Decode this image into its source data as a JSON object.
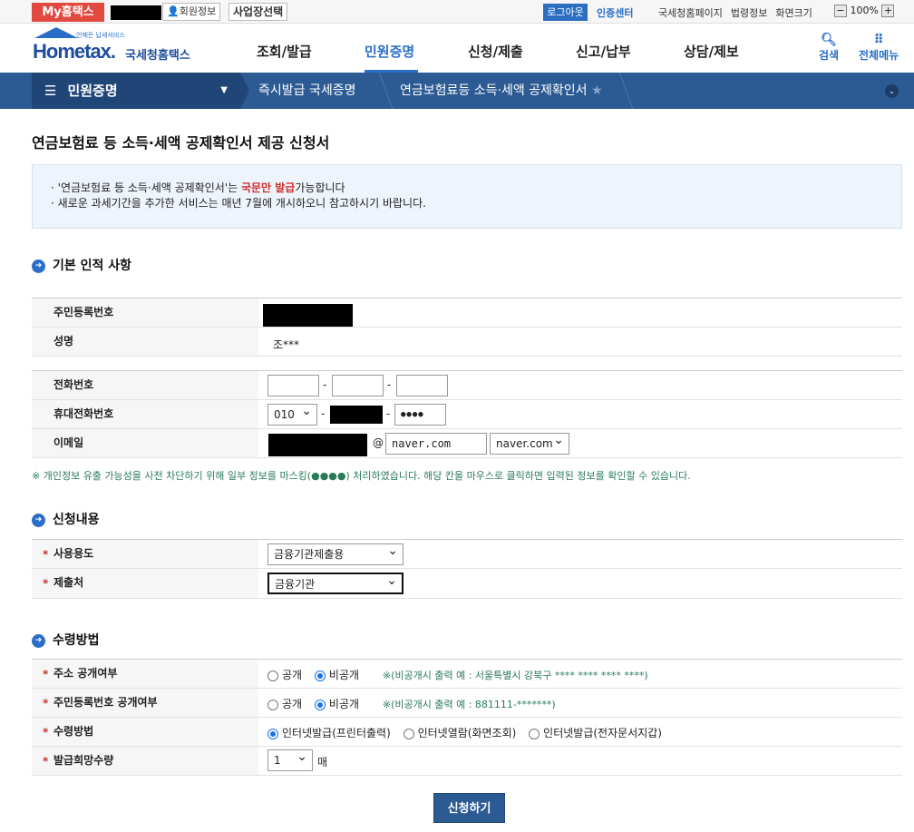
{
  "topbar": {
    "my_label": "My홈택스",
    "member_info": "회원정보",
    "business_select": "사업장선택",
    "logout": "로그아웃",
    "cert_center": "인증센터",
    "links": [
      "국세청홈페이지",
      "법령정보",
      "화면크기"
    ],
    "zoom": "100%"
  },
  "header": {
    "logo_sub": "언제든 납세서비스",
    "logo_home": "Home",
    "logo_tax": "tax.",
    "logo_kr": "국세청홈택스",
    "menu": [
      "조회/발급",
      "민원증명",
      "신청/제출",
      "신고/납부",
      "상담/제보"
    ],
    "active_menu": "민원증명",
    "search": "검색",
    "all_menu": "전체메뉴"
  },
  "navbar": {
    "menu": "민원증명",
    "crumb1": "즉시발급 국세증명",
    "crumb2": "연금보험료등 소득·세액 공제확인서"
  },
  "page_title": "연금보험료 등 소득·세액 공제확인서 제공 신청서",
  "info": {
    "line1_pre": "'연금보험료 등 소득·세액 공제확인서'는",
    "line1_red": "국문만 발급",
    "line1_post": "가능합니다",
    "line2": "새로운 과세기간을 추가한 서비스는 매년 7월에 개시하오니 참고하시기 바랍니다."
  },
  "basic": {
    "title": "기본 인적 사항",
    "rrn_label": "주민등록번호",
    "name_label": "성명",
    "name_value": "조***",
    "phone_label": "전화번호",
    "mobile_label": "휴대전화번호",
    "mobile_prefix": "010",
    "mobile_last": "●●●●",
    "email_label": "이메일",
    "email_at": "@",
    "email_domain": "naver.com",
    "email_domain_select": "naver.com",
    "dash": "-"
  },
  "notice": "※ 개인정보 유출 가능성을 사전 차단하기 위해 일부 정보를 마스킹(●●●●) 처리하였습니다. 해당 칸을 마우스로 클릭하면 입력된 정보를 확인할 수 있습니다.",
  "apply": {
    "title": "신청내용",
    "purpose_label": "사용용도",
    "purpose_value": "금융기관제출용",
    "submit_to_label": "제출처",
    "submit_to_value": "금융기관"
  },
  "receive": {
    "title": "수령방법",
    "addr_label": "주소 공개여부",
    "rrn_label": "주민등록번호 공개여부",
    "open": "공개",
    "closed": "비공개",
    "addr_hint": "※(비공개시 출력 예 : 서울특별시 강북구 **** **** **** ****)",
    "rrn_hint": "※(비공개시 출력 예 : 881111-*******)",
    "method_label": "수령방법",
    "method_options": [
      "인터넷발급(프린터출력)",
      "인터넷열람(화면조회)",
      "인터넷발급(전자문서지갑)"
    ],
    "qty_label": "발급희망수량",
    "qty_value": "1",
    "qty_unit": "매"
  },
  "submit": "신청하기"
}
